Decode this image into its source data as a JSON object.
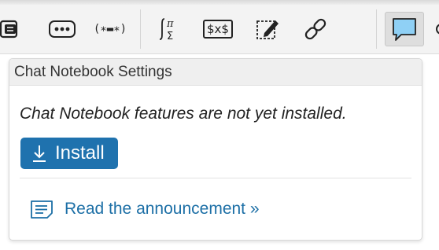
{
  "toolbar": {
    "items": [
      {
        "name": "cell-type-icon"
      },
      {
        "name": "more-options-icon"
      },
      {
        "name": "delimiters-icon",
        "glyph": "(∗▬∗)"
      },
      {
        "name": "math-template-icon"
      },
      {
        "name": "latex-icon",
        "glyph": "$x$"
      },
      {
        "name": "drawing-icon"
      },
      {
        "name": "hyperlink-icon"
      },
      {
        "name": "chat-icon",
        "active": true
      }
    ]
  },
  "popup": {
    "title": "Chat Notebook Settings",
    "message": "Chat Notebook features are not yet installed.",
    "install_label": "Install",
    "announcement_link": "Read the announcement »"
  },
  "colors": {
    "accent": "#1f72ae",
    "link": "#1c6fa6",
    "chat_icon_fill": "#8fd0f5"
  }
}
